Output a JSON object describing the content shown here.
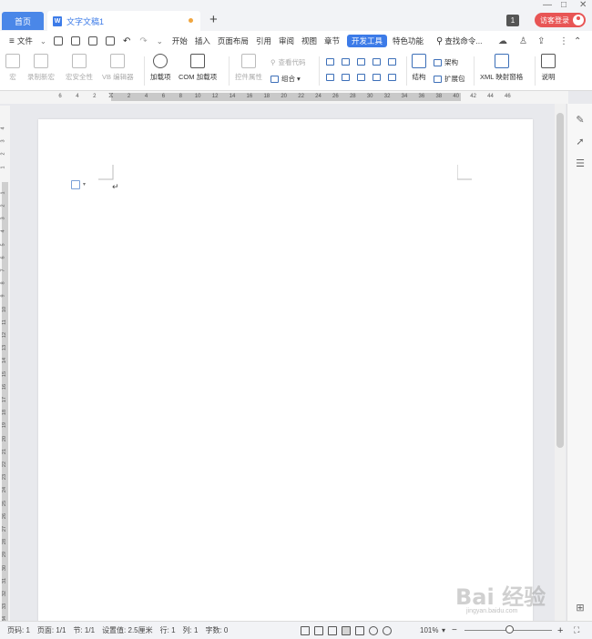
{
  "titlebar": {
    "home_tab": "首页",
    "doc_tab": "文字文稿1",
    "doc_icon": "W",
    "new_tab_icon": "+",
    "notification_count": "1",
    "login_label": "访客登录",
    "minimize": "—",
    "maximize": "□",
    "close": "✕"
  },
  "menu": {
    "file": "文件",
    "items": [
      "开始",
      "插入",
      "页面布局",
      "引用",
      "审阅",
      "视图",
      "章节",
      "开发工具",
      "特色功能"
    ],
    "active": "开发工具",
    "search": "查找命令..."
  },
  "ribbon": {
    "macro": "宏",
    "record_macro": "录制新宏",
    "macro_security": "宏安全性",
    "vb_editor": "VB 编辑器",
    "addins": "加载项",
    "com_addins": "COM 加载项",
    "control_props": "控件属性",
    "view_code": "查看代码",
    "group": "组合",
    "structure": "结构",
    "schema": "架构",
    "expansion_pack": "扩展包",
    "xml_mapping": "XML 映射窗格",
    "help": "说明"
  },
  "ruler": {
    "numbers": [
      "6",
      "4",
      "2",
      "2",
      "4",
      "6",
      "8",
      "10",
      "12",
      "14",
      "16",
      "18",
      "20",
      "22",
      "24",
      "26",
      "28",
      "30",
      "32",
      "34",
      "36",
      "38",
      "40",
      "42",
      "44",
      "46"
    ]
  },
  "vruler": {
    "numbers": [
      "4",
      "3",
      "2",
      "1",
      "1",
      "2",
      "3",
      "4",
      "5",
      "6",
      "7",
      "8",
      "9",
      "10",
      "11",
      "12",
      "13",
      "14",
      "15",
      "16",
      "17",
      "18",
      "19",
      "20",
      "21",
      "22",
      "23",
      "24",
      "25",
      "26",
      "27",
      "28",
      "29",
      "30",
      "31",
      "32",
      "33",
      "34"
    ]
  },
  "document": {
    "paragraph_mark": "↵"
  },
  "status": {
    "page": "页码: 1",
    "pages": "页面: 1/1",
    "section": "节: 1/1",
    "setting": "设置值: 2.5厘米",
    "row": "行: 1",
    "col": "列: 1",
    "words": "字数: 0",
    "zoom": "101%",
    "zoom_level": 1.01
  },
  "watermark": {
    "text": "Bai 经验",
    "url": "jingyan.baidu.com"
  }
}
